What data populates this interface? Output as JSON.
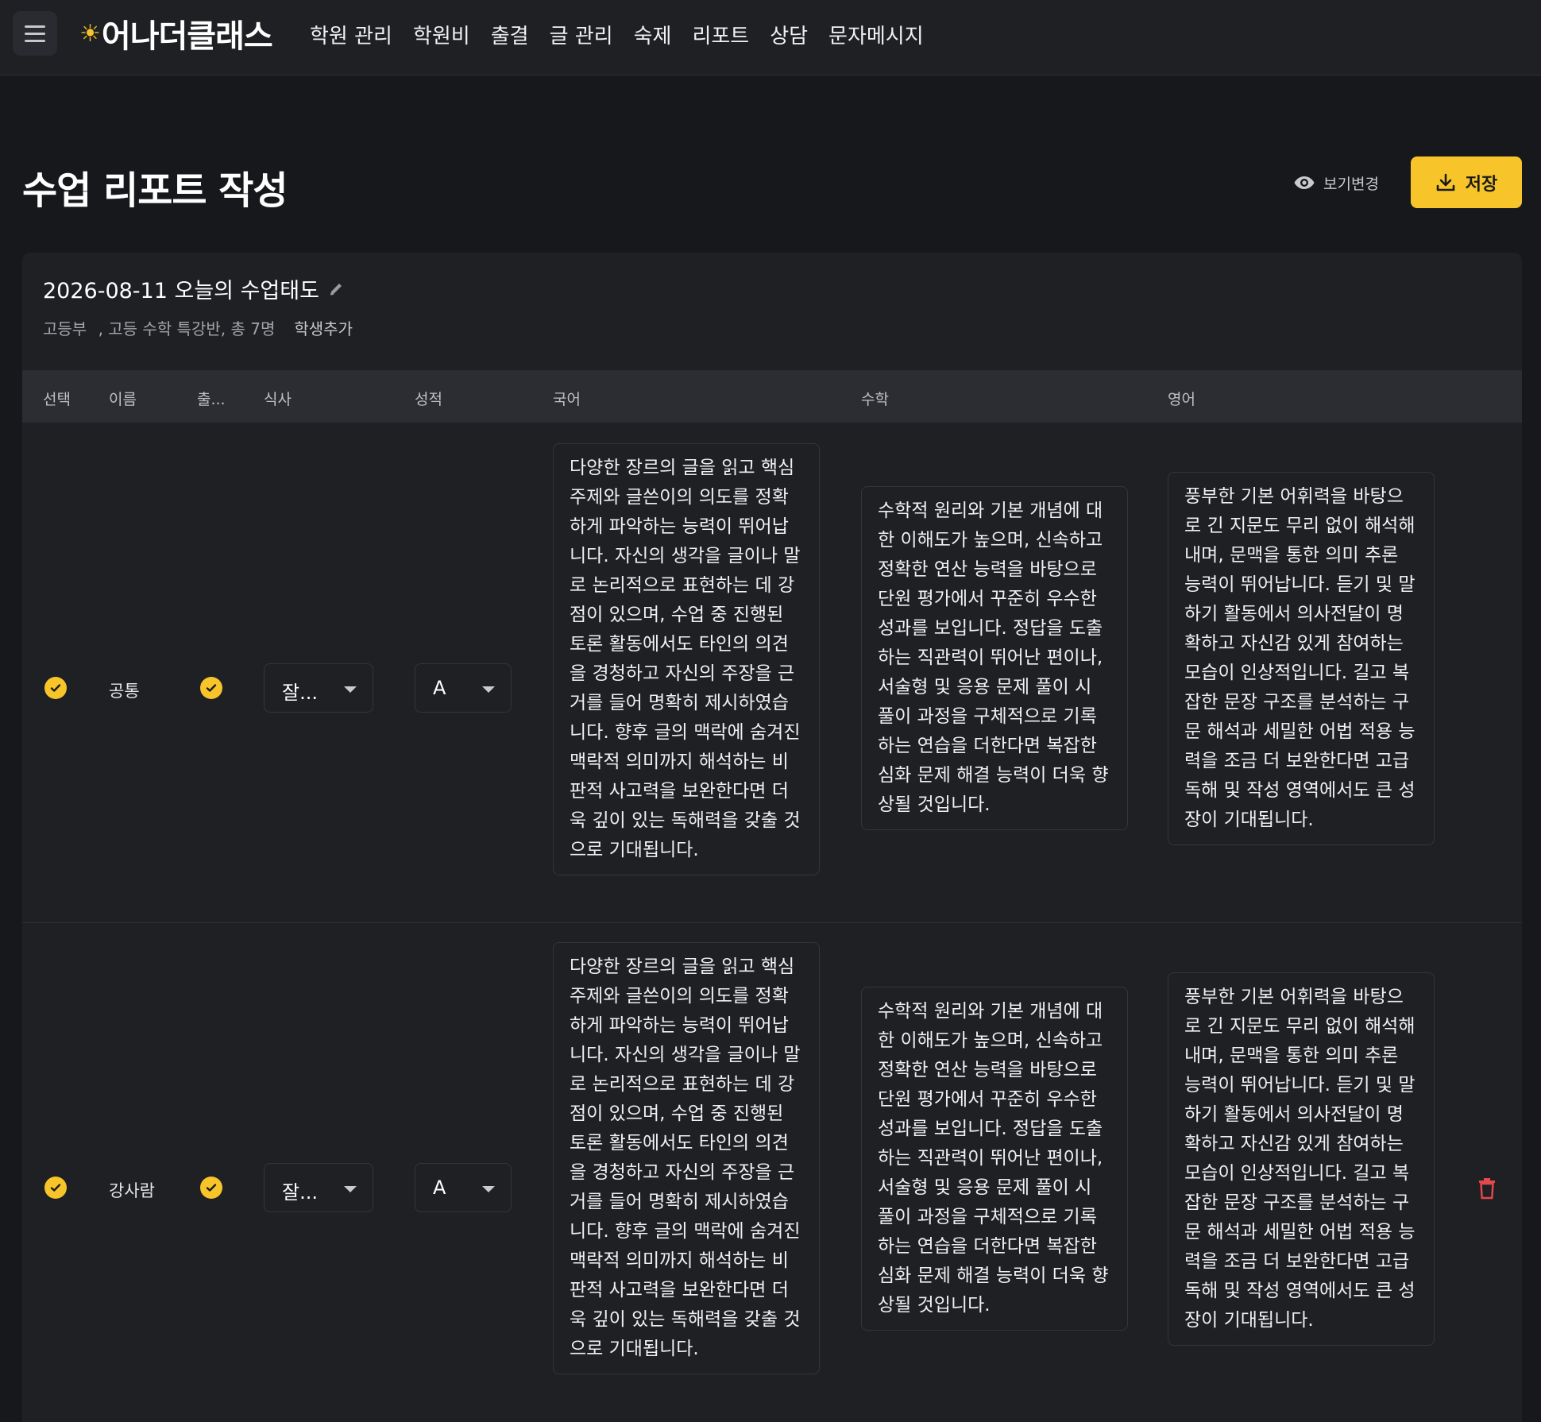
{
  "app": {
    "logo": "어나더클래스",
    "nav": [
      "학원 관리",
      "학원비",
      "출결",
      "글 관리",
      "숙제",
      "리포트",
      "상담",
      "문자메시지"
    ]
  },
  "page": {
    "title": "수업 리포트 작성",
    "view_toggle_label": "보기변경",
    "save_label": "저장"
  },
  "report": {
    "title": "2026-08-11 오늘의 수업태도",
    "division": "고등부",
    "class_info": ", 고등 수학 특강반, 총 7명",
    "add_student_label": "학생추가"
  },
  "table": {
    "columns": [
      "선택",
      "이름",
      "출...",
      "식사",
      "성적",
      "국어",
      "수학",
      "영어"
    ],
    "rows": [
      {
        "name": "공통",
        "selected": true,
        "attendance": true,
        "meal": "잘...",
        "grade": "A",
        "korean": "다양한 장르의 글을 읽고 핵심 주제와 글쓴이의 의도를 정확하게 파악하는 능력이 뛰어납니다. 자신의 생각을 글이나 말로 논리적으로 표현하는 데 강점이 있으며, 수업 중 진행된 토론 활동에서도 타인의 의견을 경청하고 자신의 주장을 근거를 들어 명확히 제시하였습니다. 향후 글의 맥락에 숨겨진 맥락적 의미까지 해석하는 비판적 사고력을 보완한다면 더욱 깊이 있는 독해력을 갖출 것으로 기대됩니다.",
        "math": "수학적 원리와 기본 개념에 대한 이해도가 높으며, 신속하고 정확한 연산 능력을 바탕으로 단원 평가에서 꾸준히 우수한 성과를 보입니다. 정답을 도출하는 직관력이 뛰어난 편이나, 서술형 및 응용 문제 풀이 시 풀이 과정을 구체적으로 기록하는 연습을 더한다면 복잡한 심화 문제 해결 능력이 더욱 향상될 것입니다.",
        "english": "풍부한 기본 어휘력을 바탕으로 긴 지문도 무리 없이 해석해 내며, 문맥을 통한 의미 추론 능력이 뛰어납니다. 듣기 및 말하기 활동에서 의사전달이 명확하고 자신감 있게 참여하는 모습이 인상적입니다. 길고 복잡한 문장 구조를 분석하는 구문 해석과 세밀한 어법 적용 능력을 조금 더 보완한다면 고급 독해 및 작성 영역에서도 큰 성장이 기대됩니다."
      },
      {
        "name": "강사람",
        "selected": true,
        "attendance": true,
        "meal": "잘...",
        "grade": "A",
        "korean": "다양한 장르의 글을 읽고 핵심 주제와 글쓴이의 의도를 정확하게 파악하는 능력이 뛰어납니다. 자신의 생각을 글이나 말로 논리적으로 표현하는 데 강점이 있으며, 수업 중 진행된 토론 활동에서도 타인의 의견을 경청하고 자신의 주장을 근거를 들어 명확히 제시하였습니다. 향후 글의 맥락에 숨겨진 맥락적 의미까지 해석하는 비판적 사고력을 보완한다면 더욱 깊이 있는 독해력을 갖출 것으로 기대됩니다.",
        "math": "수학적 원리와 기본 개념에 대한 이해도가 높으며, 신속하고 정확한 연산 능력을 바탕으로 단원 평가에서 꾸준히 우수한 성과를 보입니다. 정답을 도출하는 직관력이 뛰어난 편이나, 서술형 및 응용 문제 풀이 시 풀이 과정을 구체적으로 기록하는 연습을 더한다면 복잡한 심화 문제 해결 능력이 더욱 향상될 것입니다.",
        "english": "풍부한 기본 어휘력을 바탕으로 긴 지문도 무리 없이 해석해 내며, 문맥을 통한 의미 추론 능력이 뛰어납니다. 듣기 및 말하기 활동에서 의사전달이 명확하고 자신감 있게 참여하는 모습이 인상적입니다. 길고 복잡한 문장 구조를 분석하는 구문 해석과 세밀한 어법 적용 능력을 조금 더 보완한다면 고급 독해 및 작성 영역에서도 큰 성장이 기대됩니다."
      }
    ]
  },
  "colors": {
    "accent": "#f7c52a",
    "background": "#17181c",
    "surface": "#1f2024",
    "delete": "#e5484d"
  }
}
